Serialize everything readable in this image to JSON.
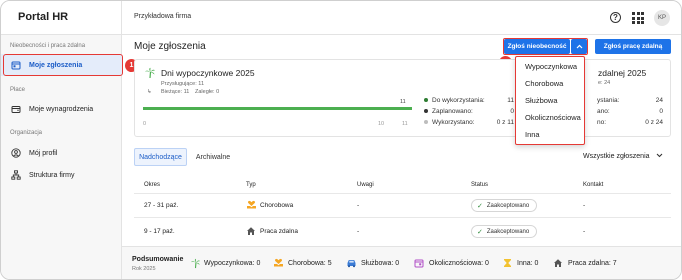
{
  "header": {
    "brand": "Portal HR",
    "company": "Przykładowa firma",
    "help_glyph": "?",
    "avatar_initials": "KP"
  },
  "sidebar": {
    "sections": [
      {
        "label": "Nieobecności i praca zdalna"
      },
      {
        "label": "Płace"
      },
      {
        "label": "Organizacja"
      }
    ],
    "items": [
      {
        "label": "Moje zgłoszenia",
        "icon": "calendar-icon",
        "active": true
      },
      {
        "label": "Moje wynagrodzenia",
        "icon": "wallet-icon"
      },
      {
        "label": "Mój profil",
        "icon": "user-icon"
      },
      {
        "label": "Struktura firmy",
        "icon": "org-chart-icon"
      }
    ]
  },
  "annotations": {
    "badge1": "1",
    "badge2": "2"
  },
  "main": {
    "title": "Moje zgłoszenia",
    "report_absence_label": "Zgłoś nieobecność",
    "report_remote_label": "Zgłoś pracę zdalną",
    "vacation_card": {
      "title": "Dni wypoczynkowe 2025",
      "entitled": "Przysługujące: 11",
      "current": "Bieżące: 11",
      "overdue": "Zaległe: 0",
      "bar_total": "11",
      "bar_start": "0",
      "bar_mid": "10",
      "bar_end": "11",
      "available_fraction": 1.0,
      "legend": [
        {
          "label": "Do wykorzystania:",
          "value": "11",
          "color": "#2e7d32"
        },
        {
          "label": "Zaplanowano:",
          "value": "0",
          "color": "#333333"
        },
        {
          "label": "Wykorzystano:",
          "value": "0 z 11",
          "color": "#bdbdbd"
        }
      ]
    },
    "remote_card": {
      "title_partial": "zdalnej 2025",
      "sub_partial": "e: 24",
      "legend": [
        {
          "label": "ystania:",
          "value": "24"
        },
        {
          "label": "ano:",
          "value": "0"
        },
        {
          "label": "no:",
          "value": "0 z 24"
        }
      ]
    },
    "dropdown": {
      "options": [
        "Wypoczynkowa",
        "Chorobowa",
        "Służbowa",
        "Okolicznościowa",
        "Inna"
      ]
    },
    "tabs": [
      {
        "label": "Nadchodzące",
        "active": true
      },
      {
        "label": "Archiwalne"
      }
    ],
    "filter_label": "Wszystkie zgłoszenia",
    "table": {
      "headers": [
        "Okres",
        "Typ",
        "Uwagi",
        "Status",
        "Kontakt"
      ],
      "rows": [
        {
          "period": "27 - 31 paź.",
          "type": "Chorobowa",
          "type_icon": "heart-hand-icon",
          "notes": "-",
          "status": "Zaakceptowano",
          "contact": "-"
        },
        {
          "period": "9 - 17 paź.",
          "type": "Praca zdalna",
          "type_icon": "home-icon",
          "notes": "-",
          "status": "Zaakceptowano",
          "contact": "-"
        }
      ]
    }
  },
  "summary": {
    "title": "Podsumowanie",
    "year": "Rok 2025",
    "items": [
      {
        "label": "Wypoczynkowa: 0",
        "icon": "palm-icon"
      },
      {
        "label": "Chorobowa: 5",
        "icon": "heart-hand-icon"
      },
      {
        "label": "Służbowa: 0",
        "icon": "car-icon"
      },
      {
        "label": "Okolicznościowa: 0",
        "icon": "calendar-event-icon"
      },
      {
        "label": "Inna: 0",
        "icon": "hourglass-icon"
      },
      {
        "label": "Praca zdalna: 7",
        "icon": "home-icon"
      }
    ]
  },
  "colors": {
    "primary": "#1e73e8",
    "annotation_red": "#e53935",
    "progress_green": "#4caf50",
    "active_nav_bg": "#e4ecfa"
  }
}
